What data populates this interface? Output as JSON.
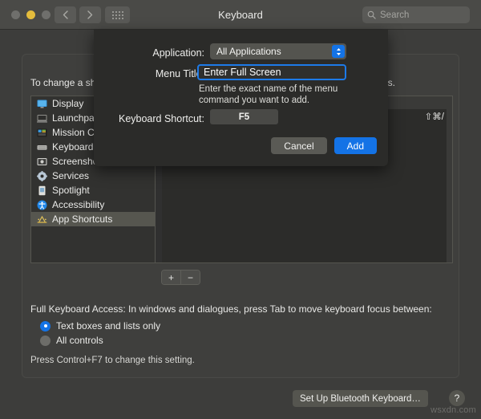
{
  "window": {
    "title": "Keyboard",
    "traffic_lights": [
      {
        "name": "close",
        "color": "#6f6f6c"
      },
      {
        "name": "minimize",
        "color": "#e4bc3c"
      },
      {
        "name": "maximize",
        "color": "#6f6f6c"
      }
    ],
    "nav": {
      "back": "‹",
      "forward": "›"
    },
    "grid_button": "show-all-icon"
  },
  "search": {
    "placeholder": "Search",
    "value": "",
    "icon": "search-icon"
  },
  "main": {
    "intro": "To change a shortcut, select it, click the key combination, and then type the new keys.",
    "sidebar": {
      "items": [
        {
          "label": "Display",
          "icon": "display-icon",
          "selected": false
        },
        {
          "label": "Launchpad & Dock",
          "icon": "launchpad-icon",
          "selected": false
        },
        {
          "label": "Mission Control",
          "icon": "mission-control-icon",
          "selected": false
        },
        {
          "label": "Keyboard",
          "icon": "keyboard-icon",
          "selected": false
        },
        {
          "label": "Screenshots",
          "icon": "screenshot-icon",
          "selected": false
        },
        {
          "label": "Services",
          "icon": "services-icon",
          "selected": false
        },
        {
          "label": "Spotlight",
          "icon": "spotlight-icon",
          "selected": false
        },
        {
          "label": "Accessibility",
          "icon": "accessibility-icon",
          "selected": false
        },
        {
          "label": "App Shortcuts",
          "icon": "app-shortcuts-icon",
          "selected": true
        }
      ]
    },
    "shortcut_list": {
      "visible_shortcut": "⇧⌘/"
    },
    "add_button": "+",
    "remove_button": "−",
    "full_keyboard_access": {
      "description": "Full Keyboard Access: In windows and dialogues, press Tab to move keyboard focus between:",
      "options": [
        {
          "label": "Text boxes and lists only",
          "selected": true
        },
        {
          "label": "All controls",
          "selected": false
        }
      ],
      "hint": "Press Control+F7 to change this setting."
    },
    "bluetooth_button": "Set Up Bluetooth Keyboard…",
    "help_button": "?"
  },
  "sheet": {
    "application": {
      "label": "Application:",
      "value": "All Applications"
    },
    "menu_title": {
      "label": "Menu Title:",
      "value": "Enter Full Screen",
      "helper": "Enter the exact name of the menu command you want to add."
    },
    "keyboard_shortcut": {
      "label": "Keyboard Shortcut:",
      "value": "F5"
    },
    "cancel_label": "Cancel",
    "add_label": "Add"
  },
  "watermark": "wsxdn.com",
  "colors": {
    "accent_blue": "#1473e6",
    "window_bg": "#3d3d3b",
    "sheet_bg": "#2b2b29",
    "titlebar": "#4a4a47",
    "selection": "#56564f"
  }
}
